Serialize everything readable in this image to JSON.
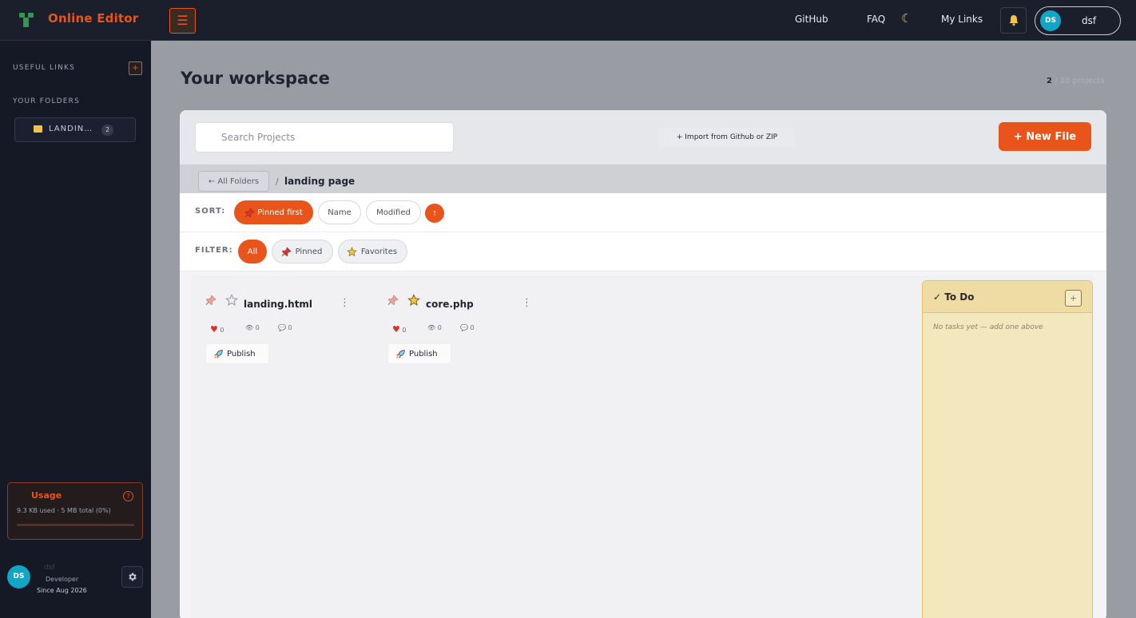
{
  "app": {
    "title": "Online Editor",
    "menu_icon": "hamburger-icon"
  },
  "topnav": {
    "github": "GitHub",
    "faq": "FAQ",
    "theme_icon": "moon-icon",
    "my_links": "My Links",
    "bell_icon": "bell-icon",
    "user_initials": "DS",
    "user_name": "dsf"
  },
  "sidebar": {
    "useful_links": "USEFUL LINKS",
    "add_label": "+",
    "your_folders": "YOUR FOLDERS",
    "folders": [
      {
        "label": "LANDIN…",
        "count": "2"
      }
    ],
    "usage": {
      "title": "Usage",
      "help": "?",
      "text": "9.3 KB used · 5 MB total (0%)",
      "percent": 0
    },
    "user": {
      "initials": "DS",
      "name": "dsf",
      "role": "Developer",
      "since": "Since Aug 2026"
    }
  },
  "main": {
    "title": "Your workspace",
    "project_count": "2",
    "project_count_suffix": "/ 10 projects",
    "search_placeholder": "Search Projects",
    "import_label": "+ Import from Github or ZIP",
    "new_file_label": "+ New File",
    "breadcrumb": {
      "back": "← All Folders",
      "sep": "/",
      "current": "landing page"
    },
    "sort": {
      "label": "SORT:",
      "options": [
        "Pinned first",
        "Name",
        "Modified"
      ],
      "active": "Pinned first",
      "direction_icon": "↑"
    },
    "filter": {
      "label": "FILTER:",
      "options": [
        "All",
        "Pinned",
        "Favorites"
      ],
      "active": "All"
    },
    "projects": [
      {
        "name": "landing.html",
        "favorite": false,
        "likes": "0",
        "views": "0",
        "comments": "0",
        "publish": "Publish"
      },
      {
        "name": "core.php",
        "favorite": true,
        "likes": "0",
        "views": "0",
        "comments": "0",
        "publish": "Publish"
      }
    ],
    "todo": {
      "title": "✓ To Do",
      "add": "+",
      "empty": "No tasks yet — add one above"
    }
  },
  "colors": {
    "accent": "#e8541a",
    "topbar": "#1b1f2b",
    "sidebar": "#151925",
    "todo_bg": "#f3e7bd"
  }
}
